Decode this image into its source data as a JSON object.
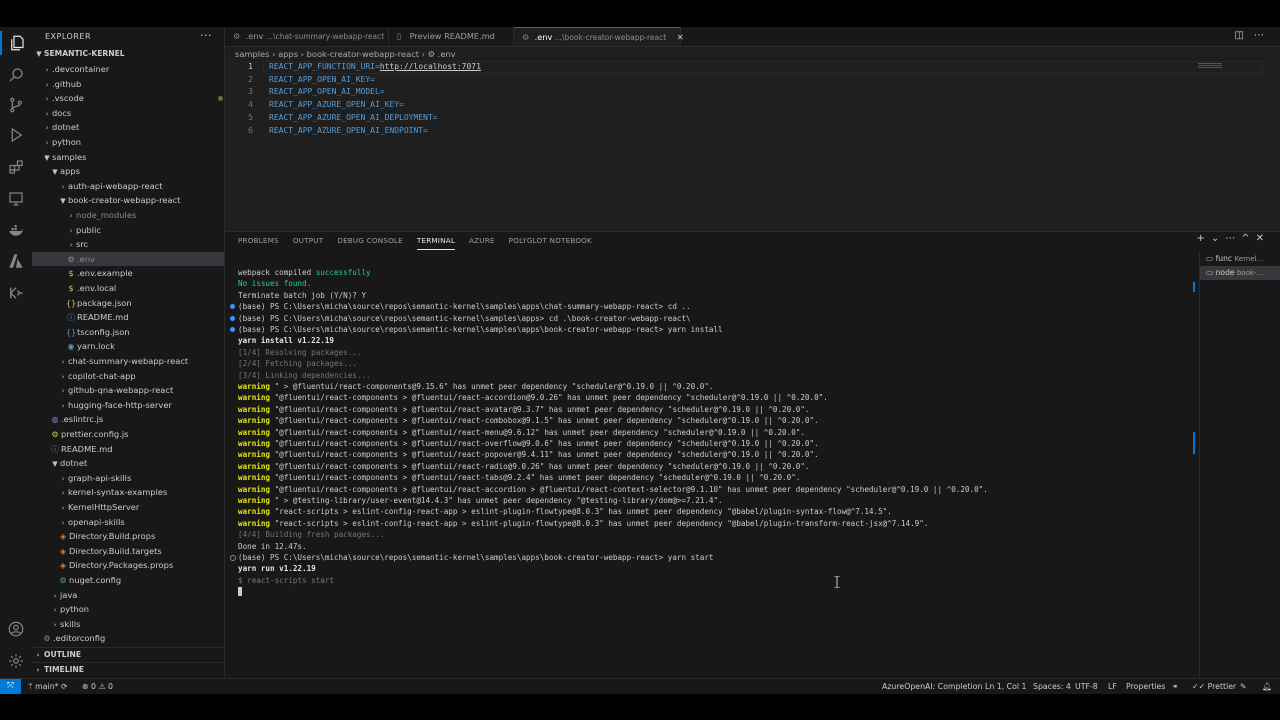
{
  "explorer": {
    "title": "EXPLORER",
    "more": "···",
    "root": "SEMANTIC-KERNEL",
    "items": [
      {
        "label": ".devcontainer",
        "kind": "folder",
        "depth": 1,
        "open": false
      },
      {
        "label": ".github",
        "kind": "folder",
        "depth": 1,
        "open": false
      },
      {
        "label": ".vscode",
        "kind": "folder",
        "depth": 1,
        "open": false,
        "modified": true
      },
      {
        "label": "docs",
        "kind": "folder",
        "depth": 1,
        "open": false
      },
      {
        "label": "dotnet",
        "kind": "folder",
        "depth": 1,
        "open": false
      },
      {
        "label": "python",
        "kind": "folder",
        "depth": 1,
        "open": false
      },
      {
        "label": "samples",
        "kind": "folder",
        "depth": 1,
        "open": true
      },
      {
        "label": "apps",
        "kind": "folder",
        "depth": 2,
        "open": true
      },
      {
        "label": "auth-api-webapp-react",
        "kind": "folder",
        "depth": 3,
        "open": false
      },
      {
        "label": "book-creator-webapp-react",
        "kind": "folder",
        "depth": 3,
        "open": true
      },
      {
        "label": "node_modules",
        "kind": "folder",
        "depth": 4,
        "open": false,
        "dim": true
      },
      {
        "label": "public",
        "kind": "folder",
        "depth": 4,
        "open": false
      },
      {
        "label": "src",
        "kind": "folder",
        "depth": 4,
        "open": false
      },
      {
        "label": ".env",
        "kind": "gear",
        "depth": 4,
        "selected": true,
        "dim": true
      },
      {
        "label": ".env.example",
        "kind": "dollar",
        "depth": 4
      },
      {
        "label": ".env.local",
        "kind": "dollar",
        "depth": 4
      },
      {
        "label": "package.json",
        "kind": "json",
        "depth": 4
      },
      {
        "label": "README.md",
        "kind": "info",
        "depth": 4
      },
      {
        "label": "tsconfig.json",
        "kind": "tsjson",
        "depth": 4
      },
      {
        "label": "yarn.lock",
        "kind": "yarn",
        "depth": 4
      },
      {
        "label": "chat-summary-webapp-react",
        "kind": "folder",
        "depth": 3,
        "open": false
      },
      {
        "label": "copilot-chat-app",
        "kind": "folder",
        "depth": 3,
        "open": false
      },
      {
        "label": "github-qna-webapp-react",
        "kind": "folder",
        "depth": 3,
        "open": false
      },
      {
        "label": "hugging-face-http-server",
        "kind": "folder",
        "depth": 3,
        "open": false
      },
      {
        "label": ".eslintrc.js",
        "kind": "eslint",
        "depth": 2
      },
      {
        "label": "prettier.config.js",
        "kind": "js",
        "depth": 2
      },
      {
        "label": "README.md",
        "kind": "info",
        "depth": 2
      },
      {
        "label": "dotnet",
        "kind": "folder",
        "depth": 2,
        "open": true
      },
      {
        "label": "graph-api-skills",
        "kind": "folder",
        "depth": 3,
        "open": false
      },
      {
        "label": "kernel-syntax-examples",
        "kind": "folder",
        "depth": 3,
        "open": false
      },
      {
        "label": "KernelHttpServer",
        "kind": "folder",
        "depth": 3,
        "open": false
      },
      {
        "label": "openapi-skills",
        "kind": "folder",
        "depth": 3,
        "open": false
      },
      {
        "label": "Directory.Build.props",
        "kind": "rss",
        "depth": 3
      },
      {
        "label": "Directory.Build.targets",
        "kind": "rss",
        "depth": 3
      },
      {
        "label": "Directory.Packages.props",
        "kind": "rss",
        "depth": 3
      },
      {
        "label": "nuget.config",
        "kind": "nuget",
        "depth": 3
      },
      {
        "label": "java",
        "kind": "folder",
        "depth": 2,
        "open": false
      },
      {
        "label": "python",
        "kind": "folder",
        "depth": 2,
        "open": false
      },
      {
        "label": "skills",
        "kind": "folder",
        "depth": 2,
        "open": false
      },
      {
        "label": ".editorconfig",
        "kind": "gear",
        "depth": 1
      }
    ],
    "outline": "OUTLINE",
    "timeline": "TIMELINE"
  },
  "tabs": [
    {
      "icon": "⚙",
      "label": ".env",
      "desc": "...\\chat-summary-webapp-react",
      "active": false
    },
    {
      "icon": "▯",
      "label": "Preview README.md",
      "desc": "",
      "active": false
    },
    {
      "icon": "⚙",
      "label": ".env",
      "desc": "...\\book-creator-webapp-react",
      "active": true
    }
  ],
  "breadcrumb": "samples  ›  apps  ›  book-creator-webapp-react  ›  ⚙ .env",
  "editor": {
    "lines": [
      {
        "n": "1",
        "key": "REACT_APP_FUNCTION_URI=",
        "val": "http://localhost:7071"
      },
      {
        "n": "2",
        "key": "REACT_APP_OPEN_AI_KEY=",
        "val": ""
      },
      {
        "n": "3",
        "key": "REACT_APP_OPEN_AI_MODEL=",
        "val": ""
      },
      {
        "n": "4",
        "key": "REACT_APP_AZURE_OPEN_AI_KEY=",
        "val": ""
      },
      {
        "n": "5",
        "key": "REACT_APP_AZURE_OPEN_AI_DEPLOYMENT=",
        "val": ""
      },
      {
        "n": "6",
        "key": "REACT_APP_AZURE_OPEN_AI_ENDPOINT=",
        "val": ""
      }
    ]
  },
  "panel": {
    "tabs": [
      "PROBLEMS",
      "OUTPUT",
      "DEBUG CONSOLE",
      "TERMINAL",
      "AZURE",
      "POLYGLOT NOTEBOOK"
    ],
    "active_tab": "TERMINAL",
    "terminals": [
      {
        "name": "func",
        "desc": "Kernel..."
      },
      {
        "name": "node",
        "desc": "book-..."
      }
    ],
    "lines": [
      [
        {
          "t": "webpack compiled "
        },
        {
          "t": "successfully",
          "c": "g"
        }
      ],
      [
        {
          "t": "No issues found.",
          "c": "g"
        }
      ],
      [
        {
          "t": "Terminate batch job (Y/N)? Y"
        }
      ],
      [
        {
          "t": "(base) PS C:\\Users\\micha\\source\\repos\\semantic-kernel\\samples\\apps\\chat-summary-webapp-react> cd .."
        }
      ],
      [
        {
          "t": "(base) PS C:\\Users\\micha\\source\\repos\\semantic-kernel\\samples\\apps> cd .\\book-creator-webapp-react\\"
        }
      ],
      [
        {
          "t": "(base) PS C:\\Users\\micha\\source\\repos\\semantic-kernel\\samples\\apps\\book-creator-webapp-react> yarn install"
        }
      ],
      [
        {
          "t": "yarn install v1.22.19",
          "c": "b"
        }
      ],
      [
        {
          "t": "[1/4] Resolving packages...",
          "c": "d"
        }
      ],
      [
        {
          "t": "[2/4] Fetching packages...",
          "c": "d"
        }
      ],
      [
        {
          "t": "[3/4] Linking dependencies...",
          "c": "d"
        }
      ],
      [
        {
          "t": "warning",
          "c": "w"
        },
        {
          "t": " \" > @fluentui/react-components@9.15.6\" has unmet peer dependency \"scheduler@^0.19.0 || ^0.20.0\"."
        }
      ],
      [
        {
          "t": "warning",
          "c": "w"
        },
        {
          "t": " \"@fluentui/react-components > @fluentui/react-accordion@9.0.26\" has unmet peer dependency \"scheduler@^0.19.0 || ^0.20.0\"."
        }
      ],
      [
        {
          "t": "warning",
          "c": "w"
        },
        {
          "t": " \"@fluentui/react-components > @fluentui/react-avatar@9.3.7\" has unmet peer dependency \"scheduler@^0.19.0 || ^0.20.0\"."
        }
      ],
      [
        {
          "t": "warning",
          "c": "w"
        },
        {
          "t": " \"@fluentui/react-components > @fluentui/react-combobox@9.1.5\" has unmet peer dependency \"scheduler@^0.19.0 || ^0.20.0\"."
        }
      ],
      [
        {
          "t": "warning",
          "c": "w"
        },
        {
          "t": " \"@fluentui/react-components > @fluentui/react-menu@9.6.12\" has unmet peer dependency \"scheduler@^0.19.0 || ^0.20.0\"."
        }
      ],
      [
        {
          "t": "warning",
          "c": "w"
        },
        {
          "t": " \"@fluentui/react-components > @fluentui/react-overflow@9.0.6\" has unmet peer dependency \"scheduler@^0.19.0 || ^0.20.0\"."
        }
      ],
      [
        {
          "t": "warning",
          "c": "w"
        },
        {
          "t": " \"@fluentui/react-components > @fluentui/react-popover@9.4.11\" has unmet peer dependency \"scheduler@^0.19.0 || ^0.20.0\"."
        }
      ],
      [
        {
          "t": "warning",
          "c": "w"
        },
        {
          "t": " \"@fluentui/react-components > @fluentui/react-radio@9.0.26\" has unmet peer dependency \"scheduler@^0.19.0 || ^0.20.0\"."
        }
      ],
      [
        {
          "t": "warning",
          "c": "w"
        },
        {
          "t": " \"@fluentui/react-components > @fluentui/react-tabs@9.2.4\" has unmet peer dependency \"scheduler@^0.19.0 || ^0.20.0\"."
        }
      ],
      [
        {
          "t": "warning",
          "c": "w"
        },
        {
          "t": " \"@fluentui/react-components > @fluentui/react-accordion > @fluentui/react-context-selector@9.1.10\" has unmet peer dependency \"scheduler@^0.19.0 || ^0.20.0\"."
        }
      ],
      [
        {
          "t": "warning",
          "c": "w"
        },
        {
          "t": " \" > @testing-library/user-event@14.4.3\" has unmet peer dependency \"@testing-library/dom@>=7.21.4\"."
        }
      ],
      [
        {
          "t": "warning",
          "c": "w"
        },
        {
          "t": " \"react-scripts > eslint-config-react-app > eslint-plugin-flowtype@8.0.3\" has unmet peer dependency \"@babel/plugin-syntax-flow@^7.14.5\"."
        }
      ],
      [
        {
          "t": "warning",
          "c": "w"
        },
        {
          "t": " \"react-scripts > eslint-config-react-app > eslint-plugin-flowtype@8.0.3\" has unmet peer dependency \"@babel/plugin-transform-react-jsx@^7.14.9\"."
        }
      ],
      [
        {
          "t": "[4/4] Building fresh packages...",
          "c": "d"
        }
      ],
      [
        {
          "t": "Done in 12.47s."
        }
      ],
      [
        {
          "t": "(base) PS C:\\Users\\micha\\source\\repos\\semantic-kernel\\samples\\apps\\book-creator-webapp-react> yarn start"
        }
      ],
      [
        {
          "t": "yarn run v1.22.19",
          "c": "b"
        }
      ],
      [
        {
          "t": "$ react-scripts start",
          "c": "d"
        }
      ]
    ],
    "blue_marks": [
      3,
      4,
      5
    ],
    "hollow_marks": [
      25
    ]
  },
  "status": {
    "branch": "main*",
    "errors": "0",
    "warnings": "0",
    "language_service": "AzureOpenAI: Completion",
    "position": "Ln 1, Col 1",
    "spaces": "Spaces: 4",
    "encoding": "UTF-8",
    "eol": "LF",
    "language": "Properties",
    "prettier": "Prettier"
  },
  "colors": {
    "accent": "#0078d4",
    "terminal_green": "#23d18b",
    "terminal_warning": "#e5e510",
    "env_key": "#569cd6"
  }
}
